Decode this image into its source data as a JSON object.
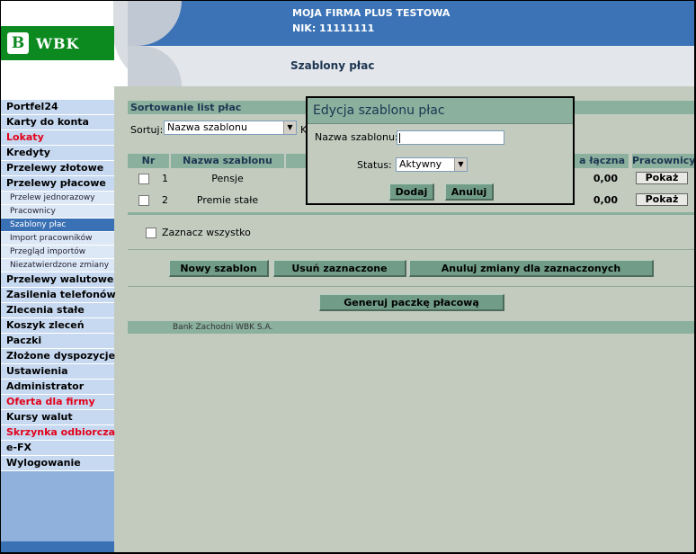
{
  "header": {
    "company": "MOJA FIRMA PLUS TESTOWA",
    "nik": "NIK: 11111111",
    "page_title": "Szablony płac",
    "logo_text": "WBK"
  },
  "sidebar": {
    "items": [
      {
        "label": "Portfel24"
      },
      {
        "label": "Karty do konta"
      },
      {
        "label": "Lokaty"
      },
      {
        "label": "Kredyty"
      },
      {
        "label": "Przelewy złotowe"
      },
      {
        "label": "Przelewy płacowe"
      },
      {
        "label": "Przelew jednorazowy"
      },
      {
        "label": "Pracownicy"
      },
      {
        "label": "Szablony płac"
      },
      {
        "label": "Import pracowników"
      },
      {
        "label": "Przegląd importów"
      },
      {
        "label": "Niezatwierdzone zmiany"
      },
      {
        "label": "Przelewy walutowe"
      },
      {
        "label": "Zasilenia telefonów"
      },
      {
        "label": "Zlecenia stałe"
      },
      {
        "label": "Koszyk zleceń"
      },
      {
        "label": "Paczki"
      },
      {
        "label": "Złożone dyspozycje"
      },
      {
        "label": "Ustawienia"
      },
      {
        "label": "Administrator"
      },
      {
        "label": "Oferta dla firmy"
      },
      {
        "label": "Kursy walut"
      },
      {
        "label": "Skrzynka odbiorcza"
      },
      {
        "label": "e-FX"
      },
      {
        "label": "Wylogowanie"
      }
    ]
  },
  "main": {
    "sort_header": "Sortowanie list płac",
    "sort_label": "Sortuj:",
    "sort_value": "Nazwa szablonu",
    "sort_extra": "K",
    "table": {
      "columns": [
        "Nr",
        "Nazwa szablonu",
        "a łączna",
        "Pracownicy"
      ],
      "rows": [
        {
          "nr": "1",
          "name": "Pensje",
          "amount": "0,00",
          "action": "Pokaż"
        },
        {
          "nr": "2",
          "name": "Premie stałe",
          "amount": "0,00",
          "action": "Pokaż"
        }
      ]
    },
    "select_all": "Zaznacz wszystko",
    "buttons": {
      "new": "Nowy szablon",
      "delete": "Usuń zaznaczone",
      "cancel_changes": "Anuluj zmiany dla zaznaczonych",
      "generate": "Generuj paczkę płacową"
    },
    "footer": "Bank Zachodni WBK S.A."
  },
  "dialog": {
    "title": "Edycja szablonu płac",
    "name_label": "Nazwa szablonu:",
    "name_value": "",
    "status_label": "Status:",
    "status_value": "Aktywny",
    "add": "Dodaj",
    "cancel": "Anuluj"
  }
}
